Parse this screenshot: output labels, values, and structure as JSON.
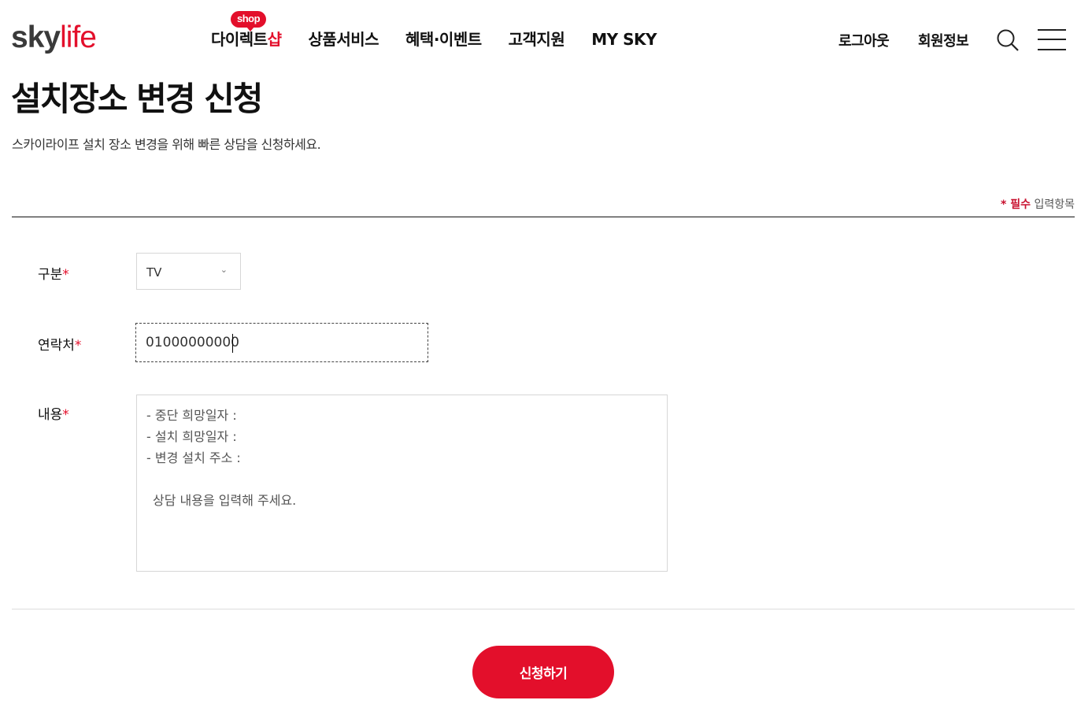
{
  "header": {
    "logo_sky": "sky",
    "logo_life": "life",
    "nav": [
      {
        "prefix": "다이렉트",
        "highlight": "샵",
        "badge": "shop"
      },
      {
        "label": "상품서비스"
      },
      {
        "label": "혜택·이벤트"
      },
      {
        "label": "고객지원"
      },
      {
        "label": "MY SKY"
      }
    ],
    "logout": "로그아웃",
    "member_info": "회원정보",
    "search_icon": "search-icon",
    "menu_icon": "hamburger-menu-icon"
  },
  "page": {
    "title": "설치장소 변경 신청",
    "description": "스카이라이프 설치 장소 변경을 위해 빠른 상담을 신청하세요.",
    "required_star": "* 필수",
    "required_text": " 입력항목"
  },
  "form": {
    "category": {
      "label": "구분",
      "star": "*",
      "value": "TV"
    },
    "contact": {
      "label": "연락처",
      "star": "*",
      "value": "01000000000"
    },
    "content": {
      "label": "내용",
      "star": "*",
      "lines": [
        "- 중단 희망일자 :",
        "- 설치 희망일자 :",
        "- 변경 설치 주소 :"
      ],
      "placeholder": "상담 내용을 입력해 주세요."
    },
    "submit": "신청하기"
  },
  "colors": {
    "accent": "#e30f2b"
  }
}
